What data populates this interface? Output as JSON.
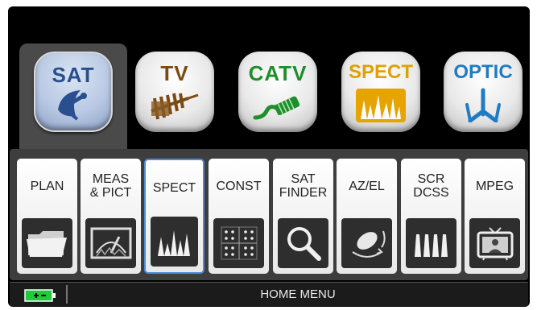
{
  "modes": [
    {
      "label": "SAT",
      "color": "#2a4f8f",
      "icon": "satellite-dish-icon",
      "selected": true
    },
    {
      "label": "TV",
      "color": "#7a4a12",
      "icon": "tv-antenna-icon",
      "selected": false
    },
    {
      "label": "CATV",
      "color": "#1f8f2a",
      "icon": "cable-connector-icon",
      "selected": false
    },
    {
      "label": "SPECT",
      "color": "#e0a000",
      "icon": "spectrum-icon",
      "selected": false
    },
    {
      "label": "OPTIC",
      "color": "#1f7cc4",
      "icon": "optical-splitter-icon",
      "selected": false
    }
  ],
  "functions": [
    {
      "label": "PLAN",
      "icon": "folder-icon",
      "selected": false
    },
    {
      "label": "MEAS\n& PICT",
      "icon": "meter-icon",
      "selected": false
    },
    {
      "label": "SPECT",
      "icon": "spectrum-icon",
      "selected": true
    },
    {
      "label": "CONST",
      "icon": "constellation-icon",
      "selected": false
    },
    {
      "label": "SAT\nFINDER",
      "icon": "magnifier-icon",
      "selected": false
    },
    {
      "label": "AZ/EL",
      "icon": "dish-orientation-icon",
      "selected": false
    },
    {
      "label": "SCR\nDCSS",
      "icon": "scr-channels-icon",
      "selected": false
    },
    {
      "label": "MPEG",
      "icon": "tv-screen-icon",
      "selected": false
    }
  ],
  "status": {
    "title": "HOME MENU",
    "battery_icon": "battery-charging-icon",
    "battery_color": "#22c93a"
  }
}
